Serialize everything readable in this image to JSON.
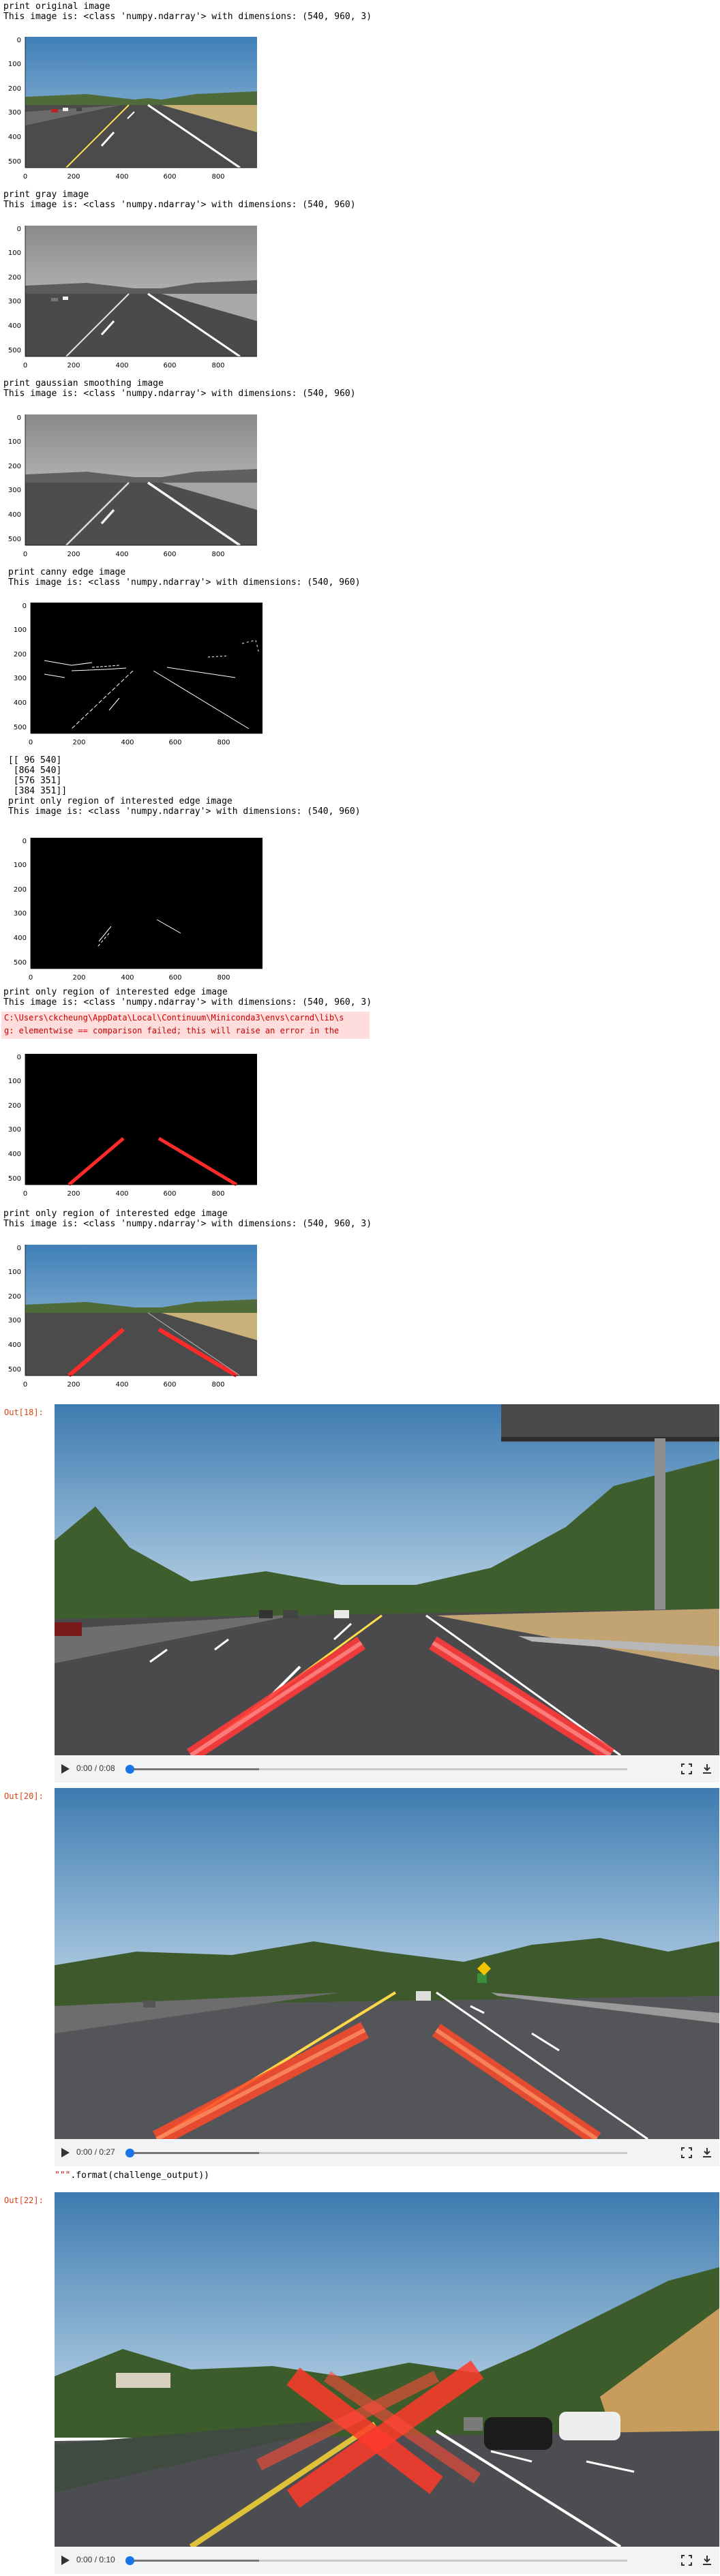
{
  "cells": {
    "original": {
      "caption": "print original image",
      "info": "This image is: <class 'numpy.ndarray'> with dimensions: (540, 960, 3)"
    },
    "gray": {
      "caption": "print gray image",
      "info": "This image is: <class 'numpy.ndarray'> with dimensions: (540, 960)"
    },
    "gaussian": {
      "caption": "print gaussian smoothing image",
      "info": "This image is: <class 'numpy.ndarray'> with dimensions: (540, 960)"
    },
    "canny": {
      "caption": "print canny edge image",
      "info": "This image is: <class 'numpy.ndarray'> with dimensions: (540, 960)"
    },
    "vertices": {
      "lines": [
        "[[ 96 540]",
        " [864 540]",
        " [576 351]",
        " [384 351]]"
      ]
    },
    "roi_edge": {
      "caption": "print only region of interested edge image",
      "info": "This image is: <class 'numpy.ndarray'> with dimensions: (540, 960)"
    },
    "roi_lines": {
      "caption": "print only region of interested edge image",
      "info": "This image is: <class 'numpy.ndarray'> with dimensions: (540, 960, 3)",
      "stderr": [
        "C:\\Users\\ckcheung\\AppData\\Local\\Continuum\\Miniconda3\\envs\\carnd\\lib\\s",
        "g: elementwise == comparison failed; this will raise an error in the"
      ]
    },
    "overlay": {
      "caption": "print only region of interested edge image",
      "info": "This image is: <class 'numpy.ndarray'> with dimensions: (540, 960, 3)"
    }
  },
  "axes": {
    "y_ticks": [
      "0",
      "100",
      "200",
      "300",
      "400",
      "500"
    ],
    "x_ticks": [
      "0",
      "200",
      "400",
      "600",
      "800"
    ]
  },
  "outputs": {
    "out18": {
      "prompt": "Out[18]:",
      "time": "0:00 / 0:08"
    },
    "out20": {
      "prompt": "Out[20]:",
      "time": "0:00 / 0:27"
    },
    "code_fragment": {
      "string": "\"\"\"",
      "rest": ".format(challenge_output))"
    },
    "out22": {
      "prompt": "Out[22]:",
      "time": "0:00 / 0:10"
    }
  },
  "colors": {
    "lane_red": "#ff2a2a",
    "stderr_bg": "#ffdddd",
    "prompt_orange": "#d84315",
    "progress_blue": "#1a73e8"
  },
  "icons": {
    "play": "play-icon",
    "fullscreen": "fullscreen-icon",
    "download": "download-icon"
  }
}
